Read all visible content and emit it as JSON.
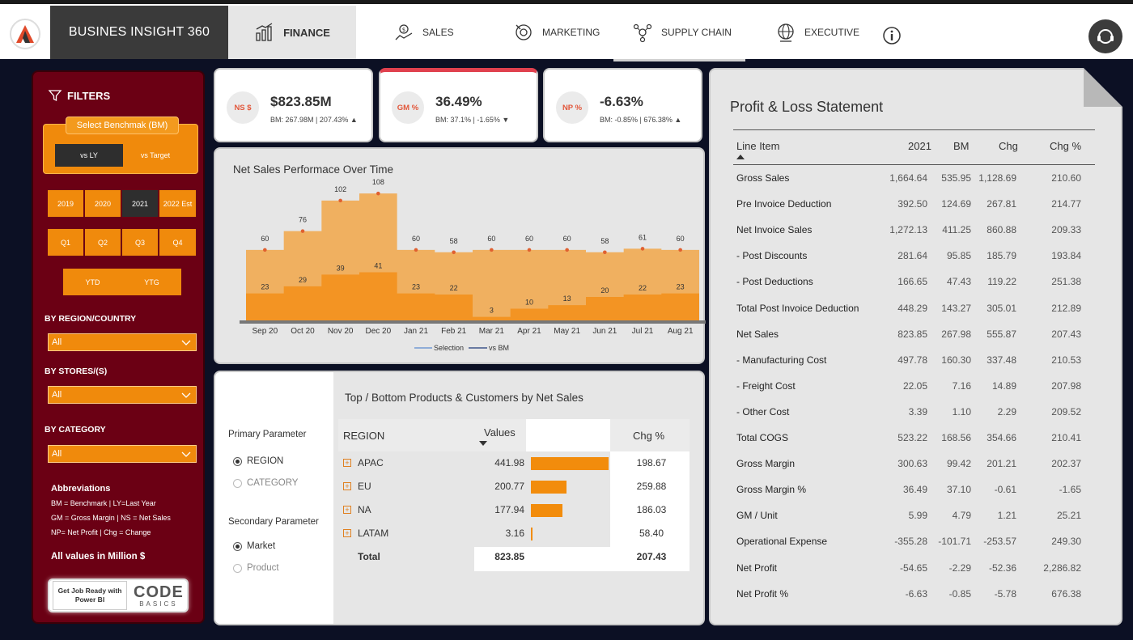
{
  "nav": {
    "brand": "BUSINES INSIGHT 360",
    "tabs": [
      {
        "label": "FINANCE",
        "icon": "finance-chart-icon",
        "active": true
      },
      {
        "label": "SALES",
        "icon": "sales-icon"
      },
      {
        "label": "MARKETING",
        "icon": "marketing-icon"
      },
      {
        "label": "SUPPLY CHAIN",
        "icon": "supply-chain-icon"
      },
      {
        "label": "EXECUTIVE",
        "icon": "executive-globe-icon"
      }
    ]
  },
  "filters": {
    "title": "FILTERS",
    "benchmark_label": "Select Benchmak (BM)",
    "benchmark_options": [
      "vs LY",
      "vs Target"
    ],
    "benchmark_selected": "vs LY",
    "years": [
      "2019",
      "2020",
      "2021",
      "2022 Est"
    ],
    "year_selected": "2021",
    "quarters": [
      "Q1",
      "Q2",
      "Q3",
      "Q4"
    ],
    "periods": [
      "YTD",
      "YTG"
    ],
    "region_label": "BY REGION/COUNTRY",
    "region_value": "All",
    "stores_label": "BY STORES/(S)",
    "stores_value": "All",
    "category_label": "BY CATEGORY",
    "category_value": "All",
    "abbr_title": "Abbreviations",
    "abbr_lines": [
      "BM = Benchmark | LY=Last Year",
      "GM = Gross Margin | NS = Net Sales",
      "NP= Net Profit | Chg = Change"
    ],
    "million_note": "All values in Million $",
    "promo_text": "Get Job Ready with Power BI",
    "promo_logo": "CODE",
    "promo_logo_sub": "BASICS"
  },
  "kpis": [
    {
      "badge": "NS $",
      "value": "$823.85M",
      "sub": "BM: 267.98M | 207.43%",
      "trend": "▲"
    },
    {
      "badge": "GM %",
      "value": "36.49%",
      "sub": "BM: 37.1% | -1.65%",
      "trend": "▼"
    },
    {
      "badge": "NP %",
      "value": "-6.63%",
      "sub": "BM: -0.85% | 676.38%",
      "trend": "▲"
    }
  ],
  "chart_data": {
    "type": "area",
    "title": "Net Sales Performace Over Time",
    "categories": [
      "Sep 20",
      "Oct 20",
      "Nov 20",
      "Dec 20",
      "Jan 21",
      "Feb 21",
      "Mar 21",
      "Apr 21",
      "May 21",
      "Jun 21",
      "Jul 21",
      "Aug 21"
    ],
    "series": [
      {
        "name": "Selection",
        "values": [
          60,
          76,
          102,
          108,
          60,
          58,
          60,
          60,
          60,
          58,
          61,
          60
        ],
        "color": "#f0b060"
      },
      {
        "name": "vs BM",
        "values": [
          23,
          29,
          39,
          41,
          23,
          22,
          3,
          10,
          13,
          20,
          22,
          23
        ],
        "color": "#f39423"
      }
    ],
    "ylim": [
      0,
      115
    ],
    "grid": false,
    "legend": "bottom-center",
    "marker_color": "#e06030"
  },
  "top_bottom": {
    "title": "Top / Bottom Products & Customers by Net Sales",
    "primary_label": "Primary Parameter",
    "primary_options": [
      "REGION",
      "CATEGORY"
    ],
    "primary_selected": "REGION",
    "secondary_label": "Secondary Parameter",
    "secondary_options": [
      "Market",
      "Product"
    ],
    "secondary_selected": "Market",
    "headers": {
      "region": "REGION",
      "values": "Values",
      "chg": "Chg %"
    },
    "rows": [
      {
        "name": "APAC",
        "value": "441.98",
        "num": 441.98,
        "chg": "198.67"
      },
      {
        "name": "EU",
        "value": "200.77",
        "num": 200.77,
        "chg": "259.88"
      },
      {
        "name": "NA",
        "value": "177.94",
        "num": 177.94,
        "chg": "186.03"
      },
      {
        "name": "LATAM",
        "value": "3.16",
        "num": 3.16,
        "chg": "58.40"
      }
    ],
    "total": {
      "label": "Total",
      "value": "823.85",
      "chg": "207.43"
    }
  },
  "pl": {
    "title": "Profit & Loss Statement",
    "headers": [
      "Line Item",
      "2021",
      "BM",
      "Chg",
      "Chg %"
    ],
    "rows": [
      [
        "Gross Sales",
        "1,664.64",
        "535.95",
        "1,128.69",
        "210.60"
      ],
      [
        "Pre Invoice Deduction",
        "392.50",
        "124.69",
        "267.81",
        "214.77"
      ],
      [
        "Net Invoice Sales",
        "1,272.13",
        "411.25",
        "860.88",
        "209.33"
      ],
      [
        "- Post Discounts",
        "281.64",
        "95.85",
        "185.79",
        "193.84"
      ],
      [
        "- Post Deductions",
        "166.65",
        "47.43",
        "119.22",
        "251.38"
      ],
      [
        "Total Post Invoice Deduction",
        "448.29",
        "143.27",
        "305.01",
        "212.89"
      ],
      [
        "Net Sales",
        "823.85",
        "267.98",
        "555.87",
        "207.43"
      ],
      [
        "- Manufacturing Cost",
        "497.78",
        "160.30",
        "337.48",
        "210.53"
      ],
      [
        "- Freight Cost",
        "22.05",
        "7.16",
        "14.89",
        "207.98"
      ],
      [
        "- Other Cost",
        "3.39",
        "1.10",
        "2.29",
        "209.52"
      ],
      [
        "Total COGS",
        "523.22",
        "168.56",
        "354.66",
        "210.41"
      ],
      [
        "Gross Margin",
        "300.63",
        "99.42",
        "201.21",
        "202.37"
      ],
      [
        "Gross Margin %",
        "36.49",
        "37.10",
        "-0.61",
        "-1.65"
      ],
      [
        "GM / Unit",
        "5.99",
        "4.79",
        "1.21",
        "25.21"
      ],
      [
        "Operational Expense",
        "-355.28",
        "-101.71",
        "-253.57",
        "249.30"
      ],
      [
        "Net Profit",
        "-54.65",
        "-2.29",
        "-52.36",
        "2,286.82"
      ],
      [
        "Net Profit %",
        "-6.63",
        "-0.85",
        "-5.78",
        "676.38"
      ]
    ]
  }
}
